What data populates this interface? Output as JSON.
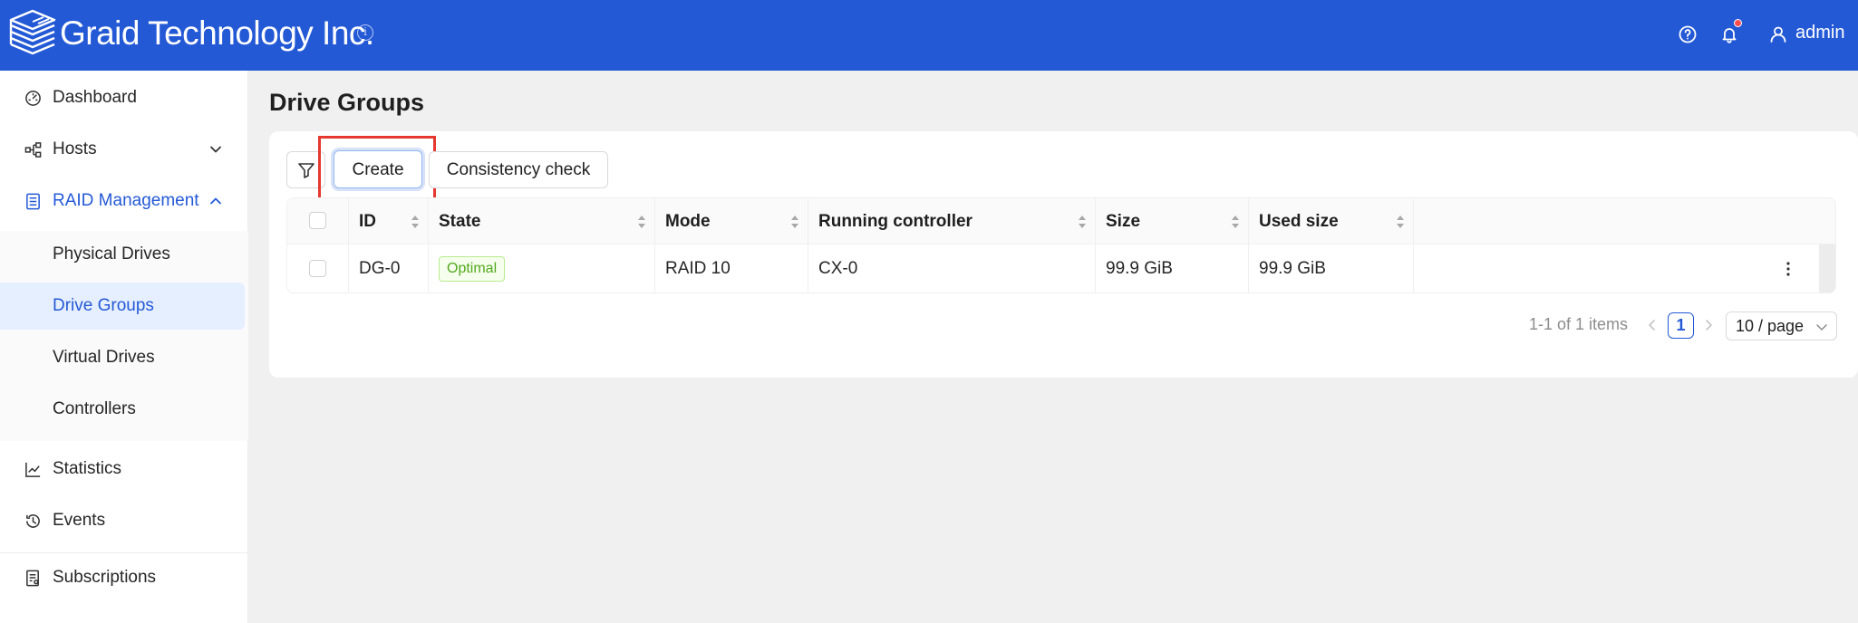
{
  "header": {
    "brand": "Graid Technology Inc.",
    "info_glyph": "i",
    "user": "admin",
    "icons": [
      "graid-logo-icon",
      "info-icon",
      "help-icon",
      "bell-icon",
      "user-icon"
    ],
    "background": "#2459d6",
    "notification_dot": "#ff4d4f"
  },
  "sidebar": {
    "items": [
      {
        "label": "Dashboard",
        "icon": "dashboard-icon"
      },
      {
        "label": "Hosts",
        "icon": "hosts-icon",
        "expand": "chevron-down-icon"
      },
      {
        "label": "RAID Management",
        "icon": "raid-icon",
        "expand": "chevron-up-icon"
      },
      {
        "label": "Statistics",
        "icon": "chart-icon"
      },
      {
        "label": "Events",
        "icon": "history-icon"
      },
      {
        "label": "Subscriptions",
        "icon": "subscriptions-icon"
      }
    ],
    "raid_sub": [
      {
        "label": "Physical Drives"
      },
      {
        "label": "Drive Groups",
        "active": true
      },
      {
        "label": "Virtual Drives"
      },
      {
        "label": "Controllers"
      }
    ],
    "accent": "#2459d6"
  },
  "main": {
    "title": "Drive Groups",
    "toolbar": {
      "create": "Create",
      "consistency_check": "Consistency check",
      "highlight_color": "#e5382f"
    },
    "table": {
      "columns": [
        "ID",
        "State",
        "Mode",
        "Running controller",
        "Size",
        "Used size"
      ],
      "rows": [
        {
          "id": "DG-0",
          "state": "Optimal",
          "mode": "RAID 10",
          "controller": "CX-0",
          "size": "99.9 GiB",
          "used": "99.9 GiB"
        }
      ]
    },
    "pagination": {
      "total": "1-1 of 1 items",
      "current_page": "1",
      "page_size": "10 / page"
    }
  }
}
